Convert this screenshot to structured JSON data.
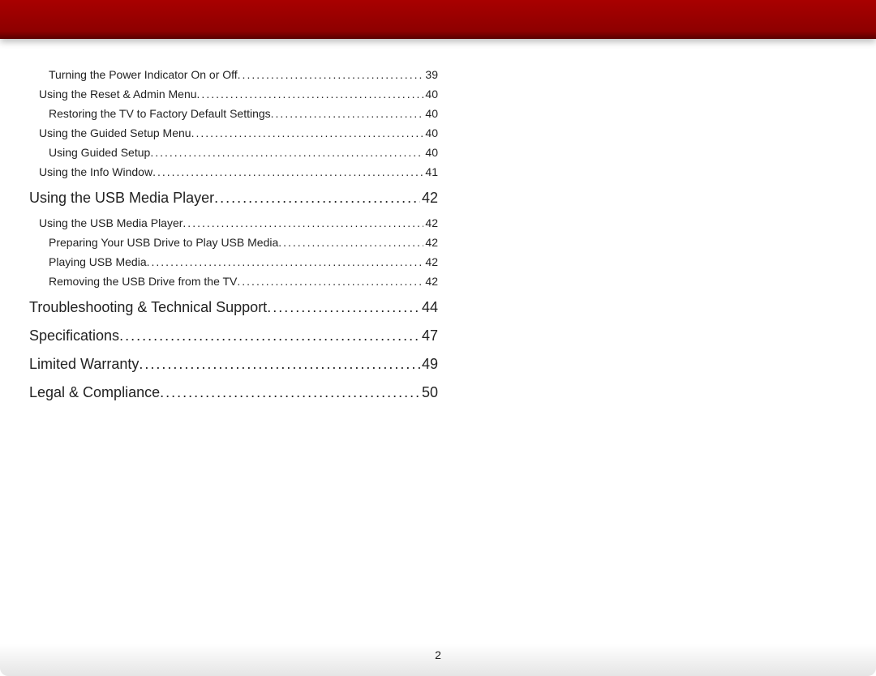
{
  "page_number": "2",
  "toc": [
    {
      "level": 3,
      "label": "Turning the Power Indicator On or Off",
      "page": "39"
    },
    {
      "level": 2,
      "label": "Using the Reset & Admin Menu",
      "page": "40"
    },
    {
      "level": 3,
      "label": "Restoring the TV to Factory Default Settings",
      "page": "40"
    },
    {
      "level": 2,
      "label": "Using the Guided Setup Menu",
      "page": "40"
    },
    {
      "level": 3,
      "label": "Using Guided Setup",
      "page": "40"
    },
    {
      "level": 2,
      "label": "Using the Info Window",
      "page": "41"
    },
    {
      "level": 1,
      "label": "Using the USB Media Player",
      "page": "42"
    },
    {
      "level": 2,
      "label": "Using the USB Media Player",
      "page": "42"
    },
    {
      "level": 3,
      "label": "Preparing Your USB Drive to Play USB Media",
      "page": "42"
    },
    {
      "level": 3,
      "label": "Playing USB Media",
      "page": "42"
    },
    {
      "level": 3,
      "label": "Removing the USB Drive from the TV",
      "page": "42"
    },
    {
      "level": 1,
      "label": "Troubleshooting & Technical Support",
      "page": "44"
    },
    {
      "level": 1,
      "label": "Specifications",
      "page": "47"
    },
    {
      "level": 1,
      "label": "Limited Warranty",
      "page": "49"
    },
    {
      "level": 1,
      "label": "Legal & Compliance",
      "page": "50"
    }
  ]
}
